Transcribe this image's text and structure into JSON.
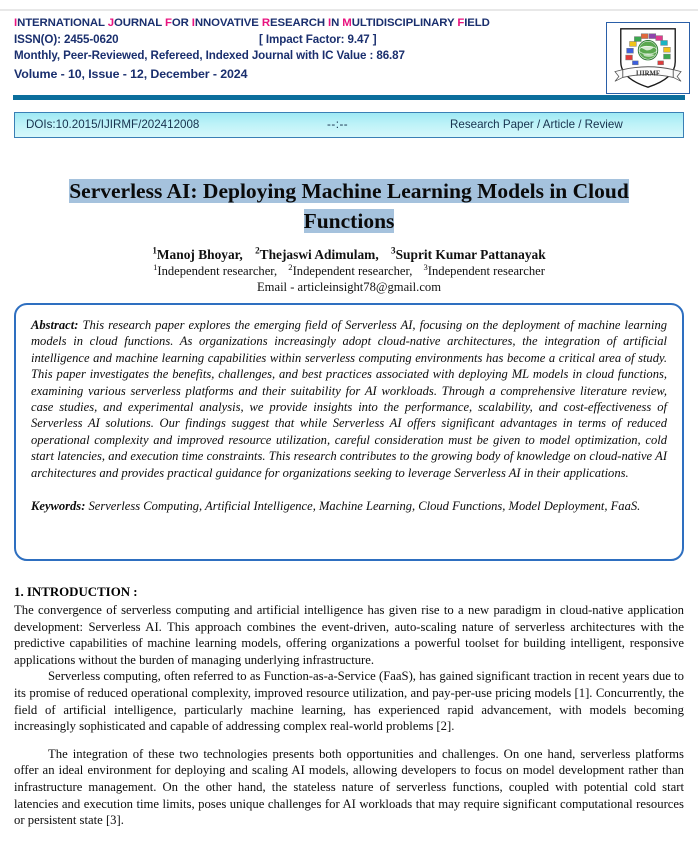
{
  "masthead": {
    "journal_name": "INTERNATIONAL JOURNAL FOR INNOVATIVE RESEARCH IN MULTIDISCIPLINARY FIELD",
    "journal_name_words": [
      "INTERNATIONAL",
      "JOURNAL",
      "FOR",
      "INNOVATIVE",
      "RESEARCH",
      "IN",
      "MULTIDISCIPLINARY",
      "FIELD"
    ],
    "issn": "ISSN(O): 2455-0620",
    "impact_factor": "[ Impact Factor: 9.47 ]",
    "journal_info": "Monthly, Peer-Reviewed, Refereed, Indexed Journal with  IC Value : 86.87",
    "volume_line": "Volume - 10,  Issue - 12,  December  -  2024",
    "logo_text": "IJIRMF",
    "accent_color": "#e8137f",
    "text_color": "#1a2f6e",
    "rule_color": "#0b6e9c"
  },
  "doi_bar": {
    "doi": "DOIs:10.2015/IJIRMF/202412008",
    "separator": "--:--",
    "article_type": "Research Paper / Article / Review",
    "background_color": "#bdf2f8"
  },
  "title": {
    "line1": "Serverless AI: Deploying Machine Learning Models in Cloud",
    "line2": "Functions",
    "highlight_color": "#a5c2dd"
  },
  "authors": {
    "names": [
      {
        "sup": "1",
        "name": "Manoj Bhoyar,"
      },
      {
        "sup": "2",
        "name": "Thejaswi Adimulam,"
      },
      {
        "sup": "3",
        "name": "Suprit Kumar Pattanayak"
      }
    ],
    "affiliations": [
      {
        "sup": "1",
        "text": "Independent researcher,"
      },
      {
        "sup": "2",
        "text": "Independent researcher,"
      },
      {
        "sup": "3",
        "text": "Independent researcher"
      }
    ],
    "email": "Email - articleinsight78@gmail.com"
  },
  "abstract": {
    "label": "Abstract:",
    "text": "This research paper explores the emerging field of Serverless AI, focusing on the deployment of machine learning models in cloud functions. As organizations increasingly adopt cloud-native architectures, the integration of artificial intelligence and machine learning capabilities within serverless computing environments has become a critical area of study. This paper investigates the benefits, challenges, and best practices associated with deploying ML models in cloud functions, examining various serverless platforms and their suitability for AI workloads. Through a comprehensive literature review, case studies, and experimental analysis, we provide insights into the performance, scalability, and cost-effectiveness of Serverless AI solutions. Our findings suggest that while Serverless AI offers significant advantages in terms of reduced operational complexity and improved resource utilization, careful consideration must be given to model optimization, cold start latencies, and execution time constraints. This research contributes to the growing body of knowledge on cloud-native AI architectures and provides practical guidance for organizations seeking to leverage Serverless AI in their applications.",
    "keywords_label": "Keywords:",
    "keywords_text": "Serverless Computing, Artificial Intelligence, Machine Learning, Cloud Functions, Model Deployment, FaaS.",
    "border_color": "#2e6fc0"
  },
  "introduction": {
    "heading": "1. INTRODUCTION :",
    "paragraph_1": "The convergence of serverless computing and artificial intelligence has given rise to a new paradigm in cloud-native application development: Serverless AI. This approach combines the event-driven, auto-scaling nature of serverless architectures with the predictive capabilities of machine learning models, offering organizations a powerful toolset for building intelligent, responsive applications without the burden of managing underlying infrastructure.",
    "paragraph_2": "Serverless computing, often referred to as Function-as-a-Service (FaaS), has gained significant traction in recent years due to its promise of reduced operational complexity, improved resource utilization, and pay-per-use pricing models [1]. Concurrently, the field of artificial intelligence, particularly machine learning, has experienced rapid advancement, with models becoming increasingly sophisticated and capable of addressing complex real-world problems [2].",
    "paragraph_3": "The integration of these two technologies presents both opportunities and challenges. On one hand, serverless platforms offer an ideal environment for deploying and scaling AI models, allowing developers to focus on model development rather than infrastructure management. On the other hand, the stateless nature of serverless functions, coupled with potential cold start latencies and execution time limits, poses unique challenges for AI workloads that may require significant computational resources or persistent state [3]."
  }
}
